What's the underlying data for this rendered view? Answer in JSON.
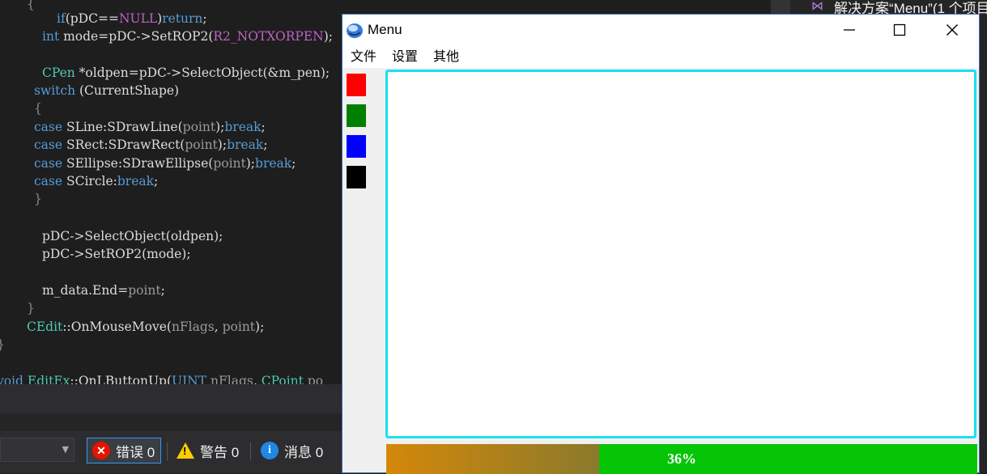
{
  "editor": {
    "lines": [
      {
        "t": "{",
        "k": "grey"
      },
      {
        "t": "if(pDC==NULL)return;",
        "k": "plain"
      },
      {
        "t": "int mode=pDC->SetROP2(R2_NOTXORPEN);",
        "k": "plain"
      },
      {
        "t": "CPen *oldpen=pDC->SelectObject(&m_pen);",
        "k": "plain"
      },
      {
        "t": "switch (CurrentShape)",
        "k": "plain"
      },
      {
        "t": "{",
        "k": "grey"
      },
      {
        "t": "case SLine:SDrawLine(point);break;",
        "k": "plain"
      },
      {
        "t": "case SRect:SDrawRect(point);break;",
        "k": "plain"
      },
      {
        "t": "case SEllipse:SDrawEllipse(point);break;",
        "k": "plain"
      },
      {
        "t": "case SCircle:break;",
        "k": "plain"
      },
      {
        "t": "}",
        "k": "grey"
      },
      {
        "t": "pDC->SelectObject(oldpen);",
        "k": "plain"
      },
      {
        "t": "pDC->SetROP2(mode);",
        "k": "plain"
      },
      {
        "t": "m_data.End=point;",
        "k": "plain"
      },
      {
        "t": "}",
        "k": "grey"
      },
      {
        "t": "CEdit::OnMouseMove(nFlags, point);",
        "k": "plain"
      },
      {
        "t": "}",
        "k": "grey"
      },
      {
        "t": "void EditEx::OnLButtonUp(UINT nFlags, CPoint po",
        "k": "plain"
      }
    ]
  },
  "error_list": {
    "errors_label": "错误 0",
    "warnings_label": "警告 0",
    "messages_label": "消息 0"
  },
  "solution_explorer": {
    "item": "解决方案“Menu”(1 个项目"
  },
  "window": {
    "title": "Menu",
    "menu": [
      "文件",
      "设置",
      "其他"
    ],
    "palette": [
      {
        "name": "red",
        "color": "#ff0000"
      },
      {
        "name": "green",
        "color": "#008000"
      },
      {
        "name": "blue",
        "color": "#0000ff"
      },
      {
        "name": "black",
        "color": "#000000"
      }
    ],
    "progress": {
      "value": 36,
      "label": "36%"
    }
  },
  "colors": {
    "accent_border": "#19e0f0",
    "progress_fill": "#06c406"
  }
}
